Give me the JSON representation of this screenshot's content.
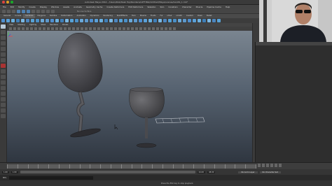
{
  "window": {
    "title": "Autodesk Maya 2014 - /Users/Rob/Desk Top/Renders/LOFTING/Untitled/Maya/scenes/GLASS_1.mb*"
  },
  "menubar": {
    "items": [
      "File",
      "Edit",
      "Modify",
      "Create",
      "Display",
      "Window",
      "Assets",
      "Animate",
      "Geometry Cache",
      "Create Deformers",
      "Edit Deformers",
      "Skeleton",
      "Skin",
      "Constrain",
      "Character",
      "Muscle",
      "Pipeline Cache",
      "Help"
    ]
  },
  "status_line": {
    "field_label": "No Live Surface"
  },
  "shelf_tabs": {
    "items": [
      "General",
      "Curves",
      "Surfaces",
      "Polygons",
      "Subdivs",
      "Deformation",
      "Animation",
      "Dynamics",
      "Rendering",
      "PaintEffects",
      "Toon",
      "Muscle",
      "Fluids",
      "Fur",
      "nHair",
      "nCloth",
      "Custom",
      "XGen",
      "Bullet"
    ],
    "active_index": 2
  },
  "panel_menu": {
    "items": [
      "View",
      "Shading",
      "Lighting",
      "Show",
      "Renderer",
      "Panels"
    ]
  },
  "viewport": {
    "camera": "persp"
  },
  "timeline": {
    "start": "1.00",
    "end": "24.00",
    "current_frame": "1.00"
  },
  "range": {
    "anim_start": "1.00",
    "play_start": "1.00",
    "play_end": "24.00",
    "anim_end": "48.00",
    "anim_layer": "No Anim Layer",
    "char_set": "No Character Set"
  },
  "command": {
    "label": "MEL"
  },
  "help_line": {
    "text": "Press the ESC key to stop playback."
  },
  "colors": {
    "viewport_top": "#7a8590",
    "viewport_bottom": "#2f3640",
    "glass": "#4a4a4e",
    "accent": "#4f7fae"
  }
}
